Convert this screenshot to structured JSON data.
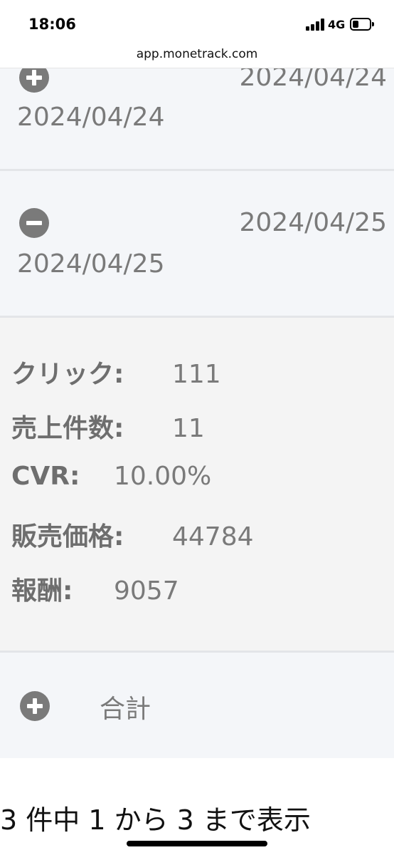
{
  "status_bar": {
    "time": "18:06",
    "network": "4G",
    "battery_level": 0.35
  },
  "url_bar": {
    "url": "app.monetrack.com"
  },
  "rows": [
    {
      "toggle_icon": "plus-circle-icon",
      "date_right": "2024/04/24",
      "date_left": "2024/04/24"
    },
    {
      "toggle_icon": "minus-circle-icon",
      "date_right": "2024/04/25",
      "date_left": "2024/04/25"
    }
  ],
  "details": {
    "clicks_label": "クリック:",
    "clicks_value": "111",
    "sales_count_label": "売上件数:",
    "sales_count_value": "11",
    "cvr_label": "CVR:",
    "cvr_value": "10.00%",
    "sale_price_label": "販売価格:",
    "sale_price_value": "44784",
    "reward_label": "報酬:",
    "reward_value": "9057"
  },
  "total_row": {
    "toggle_icon": "plus-circle-icon",
    "label": "合計"
  },
  "footer": {
    "pagination_text": "3 件中 1 から 3 まで表示"
  }
}
